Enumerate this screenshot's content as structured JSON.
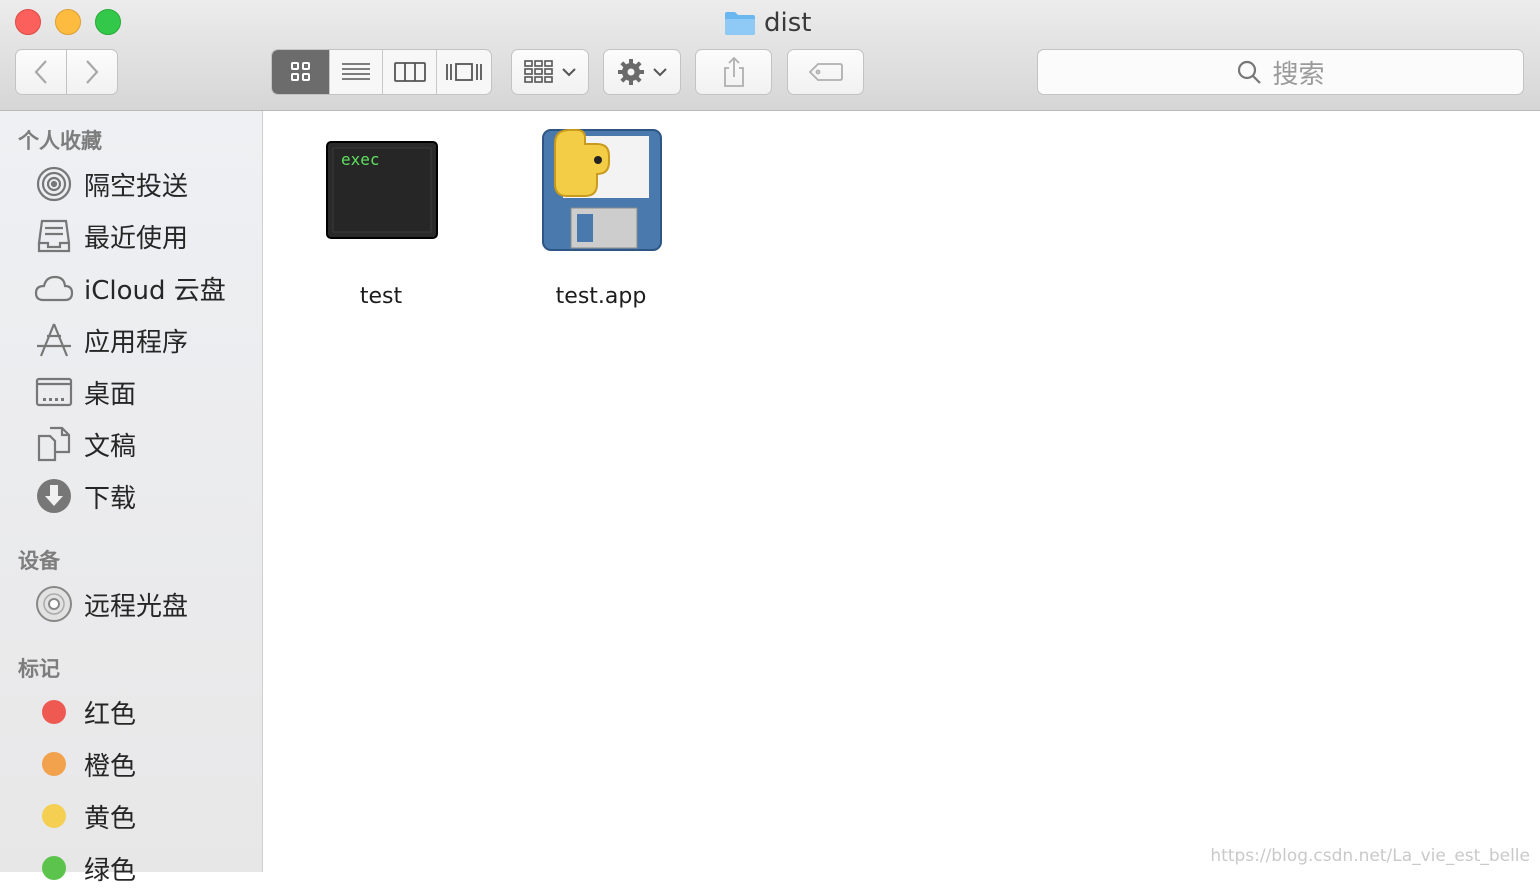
{
  "window": {
    "title": "dist"
  },
  "toolbar": {
    "back": "back",
    "forward": "forward",
    "view_modes": [
      "icon-view",
      "list-view",
      "column-view",
      "cover-flow-view"
    ],
    "active_view": "icon-view",
    "search_placeholder": "搜索"
  },
  "sidebar": {
    "favorites_header": "个人收藏",
    "favorites": [
      {
        "label": "隔空投送",
        "icon": "airdrop-icon"
      },
      {
        "label": "最近使用",
        "icon": "recents-icon"
      },
      {
        "label": "iCloud 云盘",
        "icon": "icloud-icon"
      },
      {
        "label": "应用程序",
        "icon": "applications-icon"
      },
      {
        "label": "桌面",
        "icon": "desktop-icon"
      },
      {
        "label": "文稿",
        "icon": "documents-icon"
      },
      {
        "label": "下载",
        "icon": "downloads-icon"
      }
    ],
    "devices_header": "设备",
    "devices": [
      {
        "label": "远程光盘",
        "icon": "disc-icon"
      }
    ],
    "tags_header": "标记",
    "tags": [
      {
        "label": "红色",
        "color": "#ee5a52"
      },
      {
        "label": "橙色",
        "color": "#f2a14c"
      },
      {
        "label": "黄色",
        "color": "#f4cf52"
      },
      {
        "label": "绿色",
        "color": "#5cc34c"
      }
    ]
  },
  "files": [
    {
      "name": "test",
      "icon_text": "exec",
      "icon": "unix-executable-icon"
    },
    {
      "name": "test.app",
      "icon": "python-app-icon"
    }
  ],
  "watermark": "https://blog.csdn.net/La_vie_est_belle"
}
